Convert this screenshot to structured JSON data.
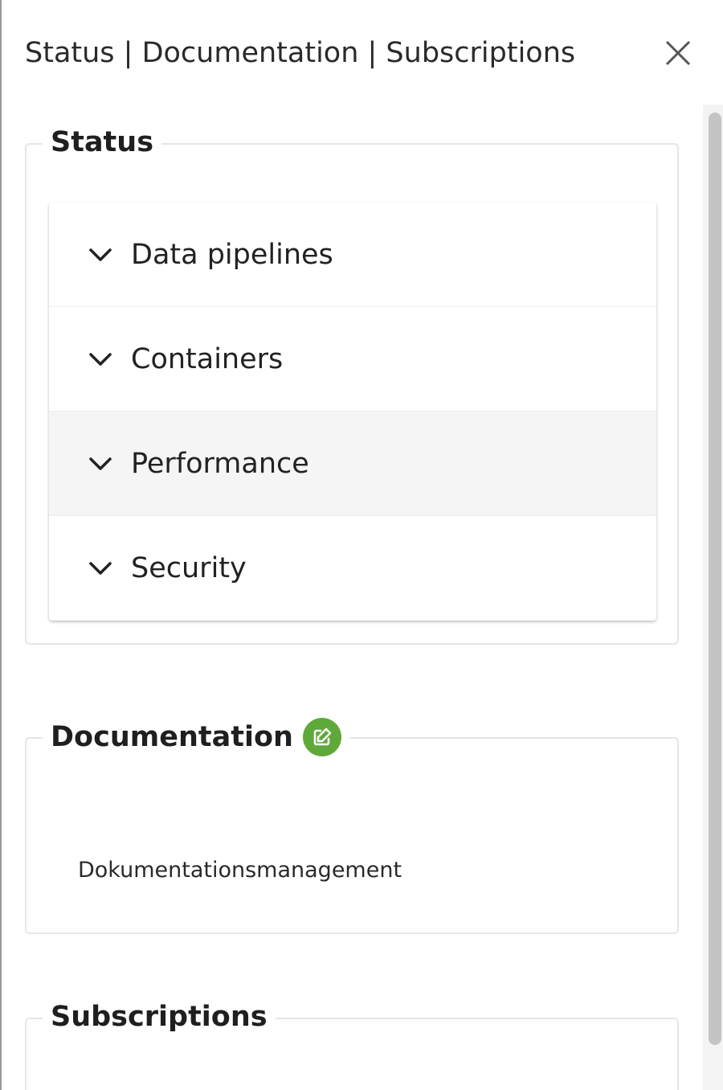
{
  "panel": {
    "title": "Status | Documentation | Subscriptions",
    "close_icon": "close-icon"
  },
  "status": {
    "legend": "Status",
    "items": [
      {
        "label": "Data pipelines",
        "icon": "chevron-down-icon"
      },
      {
        "label": "Containers",
        "icon": "chevron-down-icon"
      },
      {
        "label": "Performance",
        "icon": "chevron-down-icon"
      },
      {
        "label": "Security",
        "icon": "chevron-down-icon"
      }
    ]
  },
  "documentation": {
    "legend": "Documentation",
    "edit_icon": "edit-icon",
    "edit_color": "#5fa83a",
    "text": "Dokumentationsmanagement"
  },
  "subscriptions": {
    "legend": "Subscriptions"
  }
}
